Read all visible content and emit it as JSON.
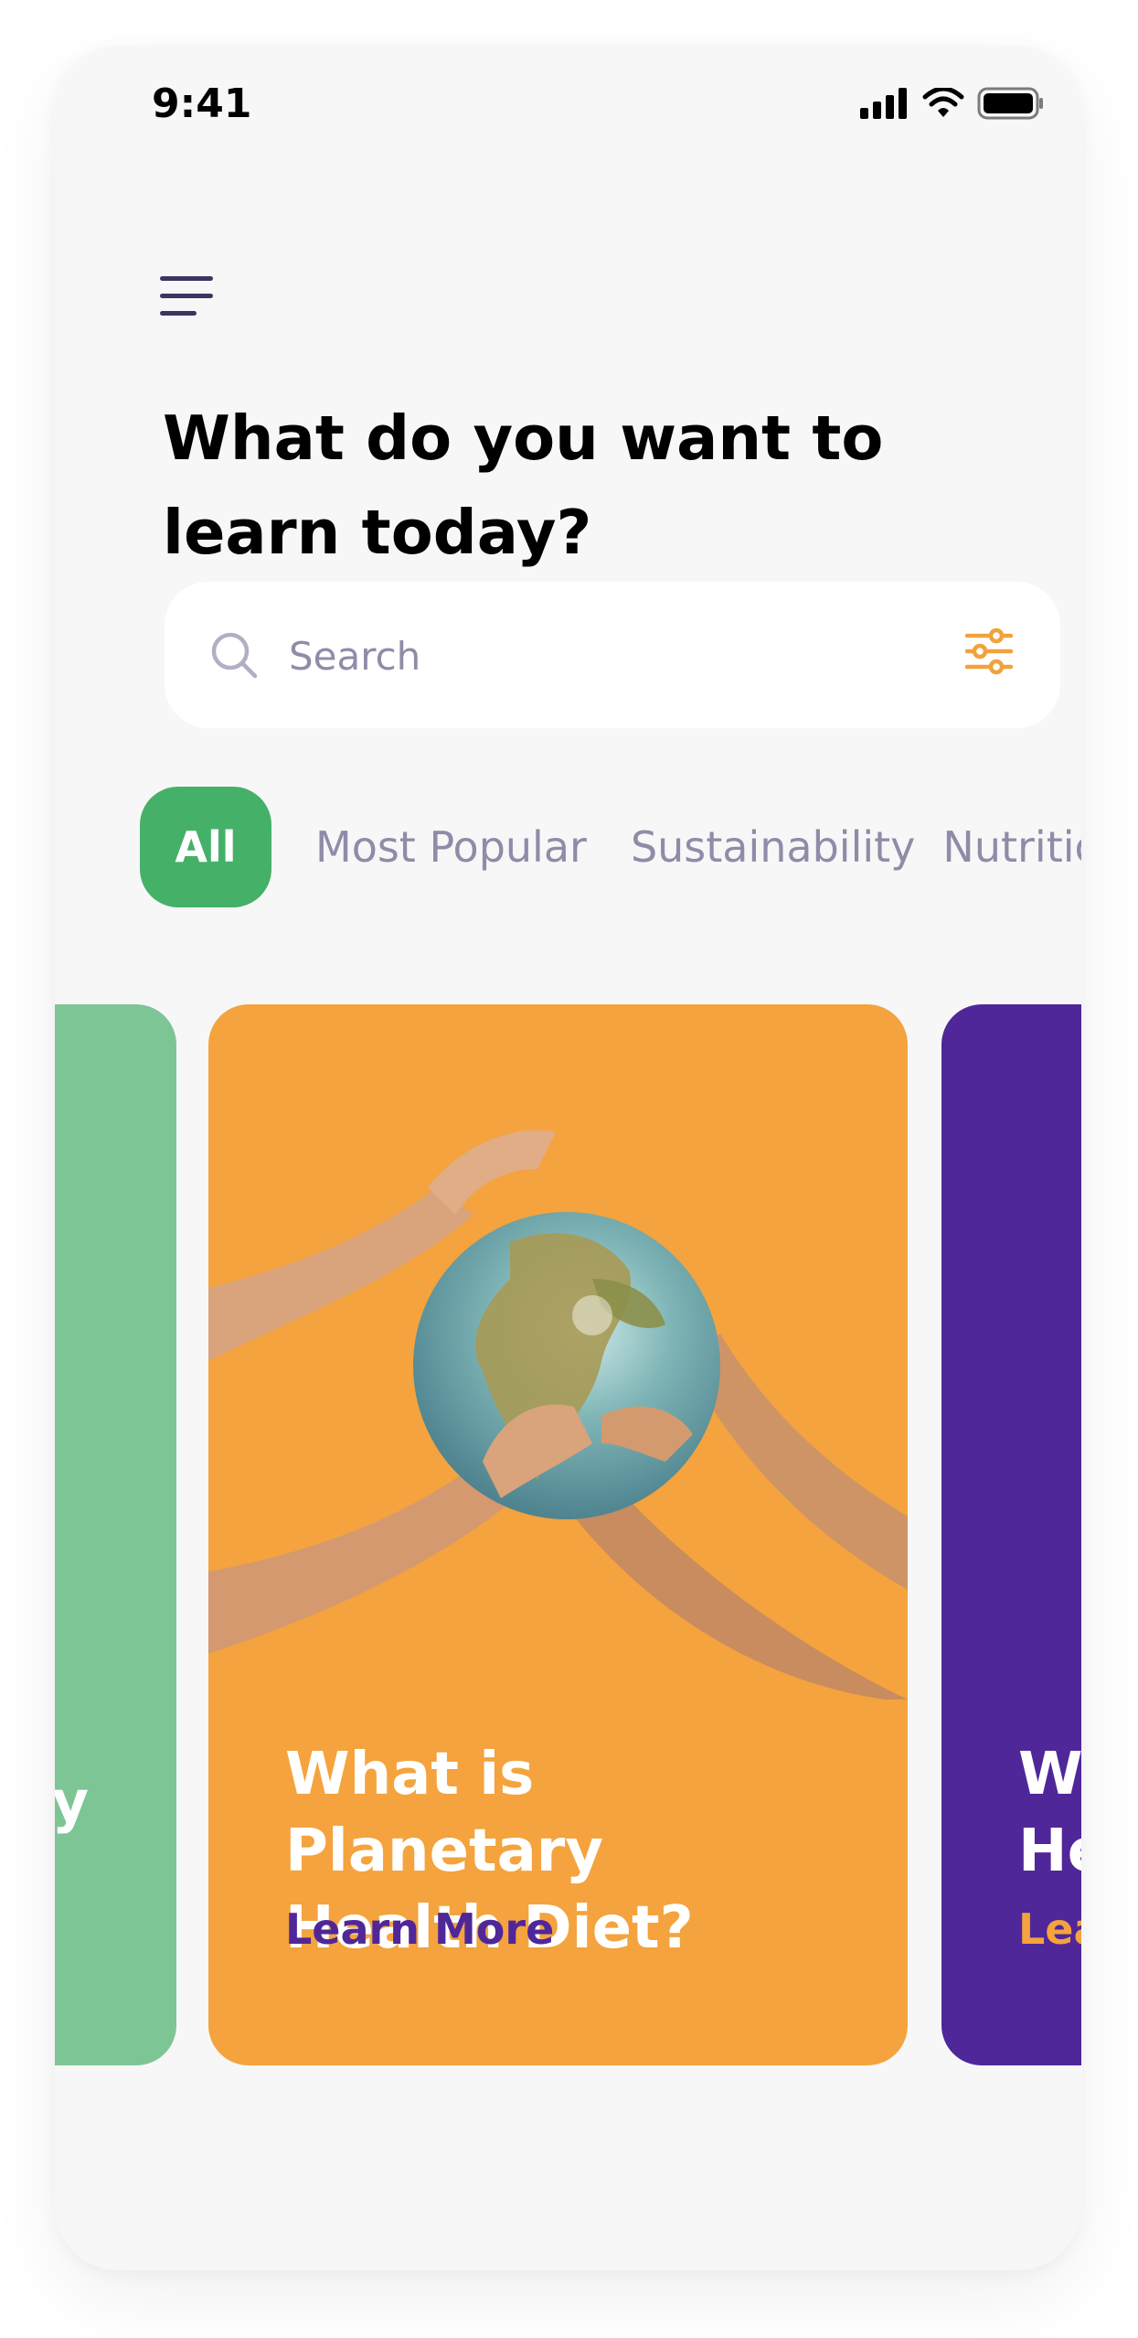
{
  "status_bar": {
    "time": "9:41"
  },
  "header": {
    "title": "What do you want to\nlearn today?"
  },
  "search": {
    "placeholder": "Search"
  },
  "categories": [
    {
      "label": "All",
      "active": true
    },
    {
      "label": "Most Popular",
      "active": false
    },
    {
      "label": "Sustainability",
      "active": false
    },
    {
      "label": "Nutritio",
      "active": false
    }
  ],
  "cards": {
    "previous": {
      "title_fragment": "y"
    },
    "main": {
      "title": "What is Planetary\nHealth Diet?",
      "link": "Learn More"
    },
    "next": {
      "title_fragment": "Wh\nHe",
      "link_fragment": "Lea"
    }
  },
  "colors": {
    "accent_green": "#45b068",
    "card_green": "#7ec596",
    "card_orange": "#f4a33e",
    "card_purple": "#4f2799",
    "muted_text": "#8e8ca8"
  },
  "icons": [
    "menu-icon",
    "search-icon",
    "filter-icon",
    "signal-icon",
    "wifi-icon",
    "battery-icon"
  ]
}
